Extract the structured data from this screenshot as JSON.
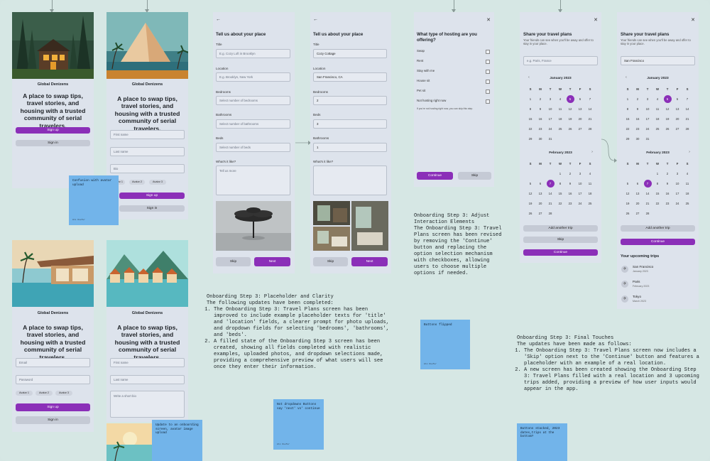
{
  "colors": {
    "canvas": "#d6e7e4",
    "screen": "#dde3ec",
    "primary": "#8b2fb8",
    "sticky": "#72b4ea"
  },
  "brand": "Global Denizens",
  "hero": "A place to swap tips, travel stories, and housing with a trusted community of serial travelers.",
  "buttons": {
    "sign_up": "Sign up",
    "sign_in": "Sign in",
    "skip": "Skip",
    "next": "Next",
    "continue": "Continue",
    "add_trip": "Add another trip"
  },
  "screen2": {
    "first_name": "First name",
    "last_name": "Last name",
    "bio": "Bio",
    "avatars": [
      "Avatar 1",
      "Avatar 2",
      "Avatar 3"
    ]
  },
  "screen3": {
    "email": "Email",
    "password": "Password",
    "avatars": [
      "Avatar 1",
      "Avatar 2",
      "Avatar 3"
    ]
  },
  "screen4": {
    "first_name": "First name",
    "last_name": "Last name",
    "bio": "Write a short bio"
  },
  "place_form": {
    "title": "Tell us about your place",
    "labels": {
      "title": "Title",
      "location": "Location",
      "bedrooms": "Bedrooms",
      "bathrooms": "Bathrooms",
      "beds": "Beds",
      "like": "What's it like?"
    },
    "placeholders": {
      "title": "E.g. Cozy Loft in Brooklyn",
      "location": "E.g. Brooklyn, New York",
      "bedrooms": "Select number of bedrooms",
      "bathrooms": "Select number of bathrooms",
      "beds": "Select number of beds",
      "like": "Tell us more"
    }
  },
  "place_filled": {
    "title": "Cozy Cottage",
    "location": "San Francisco, CA",
    "bedrooms": "2",
    "beds": "3",
    "bathrooms": "1"
  },
  "hosting": {
    "title": "What type of hosting are you offering?",
    "options": [
      "Swap",
      "Rent",
      "Stay with me",
      "House sit",
      "Pet sit",
      "Not hosting right now"
    ],
    "footnote": "If you're not hosting right now, you can skip this step."
  },
  "travel": {
    "title": "Share your travel plans",
    "subtitle": "Your friends can see when you'll be away and offer to stay in your place.",
    "placeholder": "e.g. Paris, France",
    "filled": "San Francisco",
    "months": [
      "January 2023",
      "February 2023"
    ],
    "weekdays": [
      "S",
      "M",
      "T",
      "W",
      "T",
      "F",
      "S"
    ],
    "upcoming_title": "Your upcoming trips",
    "trips": [
      {
        "name": "San Francisco",
        "date": "January 2023"
      },
      {
        "name": "Paris",
        "date": "February 2023"
      },
      {
        "name": "Tokyo",
        "date": "March 2023"
      }
    ]
  },
  "stickies": {
    "avatar": "Confusion with avatar upload",
    "onboarding": "Update to an onboarding screen, avatar image upload",
    "dropdowns": "Not dropdowns Buttons say 'next' vs' continue",
    "flipped": "Buttons flipped",
    "stacked": "Buttons stacked, 2023 dates,trips at the bottom?",
    "author": "Ali Kiefer"
  },
  "notes": {
    "n1_title": "Onboarding Step 3: Placeholder and Clarity",
    "n1_intro": "The following updates have been completed:",
    "n1_items": [
      "The Onboarding Step 3: Travel Plans screen has been improved to include example placeholder texts for 'title' and 'location' fields, a clearer prompt for photo uploads, and dropdown fields for selecting 'bedrooms', 'bathrooms', and 'beds'.",
      "A filled state of the Onboarding Step 3 screen has been created, showing all fields completed with realistic examples, uploaded photos, and dropdown selections made, providing a comprehensive preview of what users will see once they enter their information."
    ],
    "n2_title": "Onboarding Step 3: Adjust Interaction Elements",
    "n2_body": "The Onboarding Step 3: Travel Plans screen has been revised by removing the 'Continue' button and replacing the option selection mechanism with checkboxes, allowing users to choose multiple options if needed.",
    "n3_title": "Onboarding Step 3: Final Touches",
    "n3_intro": "The updates have been made as follows:",
    "n3_items": [
      "The Onboarding Step 3: Travel Plans screen now includes a 'Skip' option next to the 'Continue' button and features a placeholder with an example of a real location.",
      "A new screen has been created showing the Onboarding Step 3: Travel Plans filled with a real location and 3 upcoming trips added, providing a preview of how user inputs would appear in the app."
    ]
  }
}
